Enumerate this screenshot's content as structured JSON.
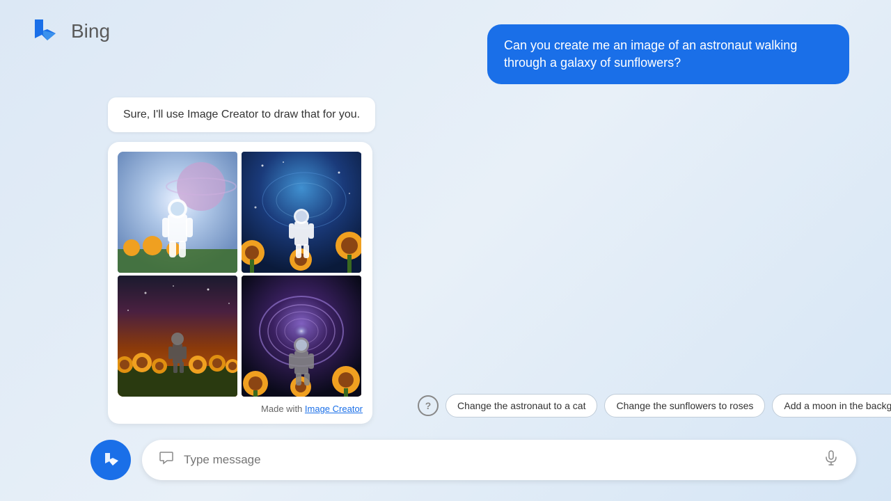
{
  "header": {
    "logo_text": "Bing",
    "title": "Bing"
  },
  "user_message": {
    "text": "Can you create me an image of an astronaut walking through a galaxy of sunflowers?"
  },
  "bot_response": {
    "text": "Sure, I'll use Image Creator to draw that for you.",
    "made_with_text": "Made with ",
    "made_with_link": "Image Creator"
  },
  "suggestion_chips": {
    "help_icon": "?",
    "chip1": "Change the astronaut to a cat",
    "chip2": "Change the sunflowers to roses",
    "chip3": "Add a moon in the background"
  },
  "input": {
    "placeholder": "Type message"
  },
  "images": [
    {
      "label": "Astronaut galaxy image 1",
      "gradient_top": "#c8d8f0",
      "gradient_bottom": "#6890c0"
    },
    {
      "label": "Astronaut sunflowers image 2",
      "gradient_top": "#1a3a6a",
      "gradient_bottom": "#d4820a"
    },
    {
      "label": "Astronaut sunflower field image 3",
      "gradient_top": "#1a1a2e",
      "gradient_bottom": "#d4820a"
    },
    {
      "label": "Astronaut portal image 4",
      "gradient_top": "#0a0a1a",
      "gradient_bottom": "#d4820a"
    }
  ]
}
